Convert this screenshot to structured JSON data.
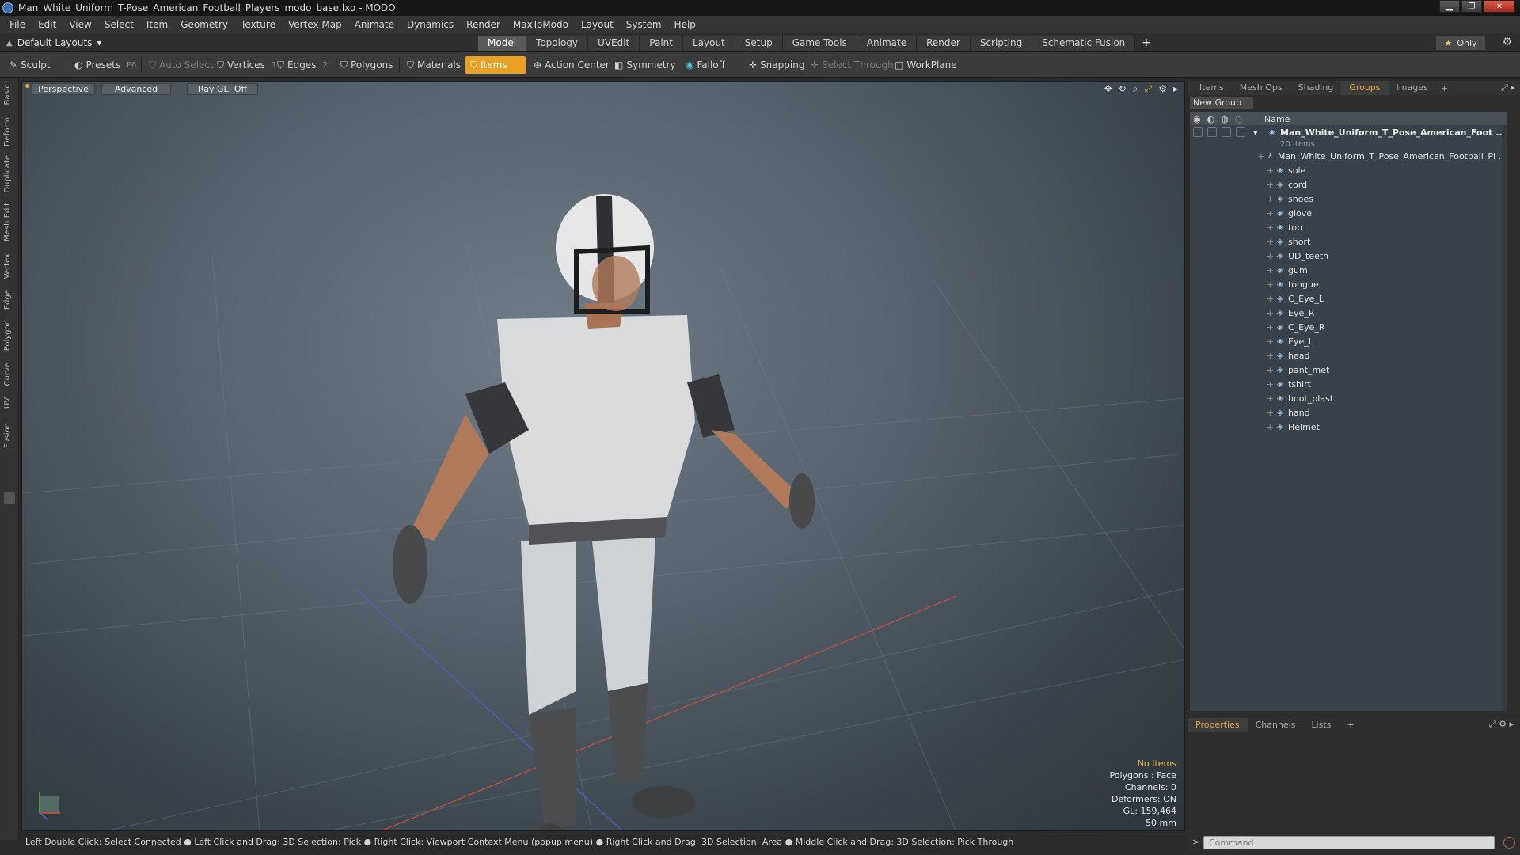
{
  "window": {
    "title": "Man_White_Uniform_T-Pose_American_Football_Players_modo_base.lxo - MODO",
    "controls": [
      "minimize",
      "maximize",
      "close"
    ]
  },
  "menu": [
    "File",
    "Edit",
    "View",
    "Select",
    "Item",
    "Geometry",
    "Texture",
    "Vertex Map",
    "Animate",
    "Dynamics",
    "Render",
    "MaxToModo",
    "Layout",
    "System",
    "Help"
  ],
  "layout": {
    "selector": "Default Layouts",
    "tabs": [
      "Model",
      "Topology",
      "UVEdit",
      "Paint",
      "Layout",
      "Setup",
      "Game Tools",
      "Animate",
      "Render",
      "Scripting",
      "Schematic Fusion"
    ],
    "active_tab": "Model",
    "add_tab": "+",
    "only_label": "Only"
  },
  "toolbar": {
    "sculpt": "Sculpt",
    "presets": "Presets",
    "presets_key": "F6",
    "auto_select": "Auto Select",
    "vertices": "Vertices",
    "vertices_key": "1",
    "edges": "Edges",
    "edges_key": "2",
    "polygons": "Polygons",
    "materials": "Materials",
    "items": "Items",
    "action_center": "Action Center",
    "symmetry": "Symmetry",
    "falloff": "Falloff",
    "snapping": "Snapping",
    "select_through": "Select Through",
    "workplane": "WorkPlane"
  },
  "left_tabs": [
    "Basic",
    "Deform",
    "Duplicate",
    "Mesh Edit",
    "Vertex",
    "Edge",
    "Polygon",
    "Curve",
    "UV",
    "Fusion"
  ],
  "viewport": {
    "view": "Perspective",
    "shading": "Advanced",
    "raygl": "Ray GL: Off",
    "stats": {
      "selection": "No Items",
      "polygons": "Polygons : Face",
      "channels": "Channels: 0",
      "deformers": "Deformers: ON",
      "gl": "GL: 159,464",
      "distance": "50 mm"
    }
  },
  "status_bar": "Left Double Click: Select Connected ● Left Click and Drag: 3D Selection: Pick ● Right Click: Viewport Context Menu (popup menu) ● Right Click and Drag: 3D Selection: Area ● Middle Click and Drag: 3D Selection: Pick Through",
  "command": {
    "placeholder": "Command"
  },
  "right_panel": {
    "tabs": [
      "Items",
      "Mesh Ops",
      "Shading",
      "Groups",
      "Images"
    ],
    "active_tab": "Groups",
    "new_group": "New Group",
    "column_name": "Name",
    "root": {
      "name": "Man_White_Uniform_T_Pose_American_Foot ...",
      "count": "20 Items"
    },
    "items": [
      "Man_White_Uniform_T_Pose_American_Football_Pl ...",
      "sole",
      "cord",
      "shoes",
      "glove",
      "top",
      "short",
      "UD_teeth",
      "gum",
      "tongue",
      "C_Eye_L",
      "Eye_R",
      "C_Eye_R",
      "Eye_L",
      "head",
      "pant_met",
      "tshirt",
      "boot_plast",
      "hand",
      "Helmet"
    ]
  },
  "props_panel": {
    "tabs": [
      "Properties",
      "Channels",
      "Lists"
    ],
    "active_tab": "Properties"
  },
  "colors": {
    "accent": "#e9a023",
    "background": "#2b2b2b",
    "tree_bg": "#39424a"
  }
}
